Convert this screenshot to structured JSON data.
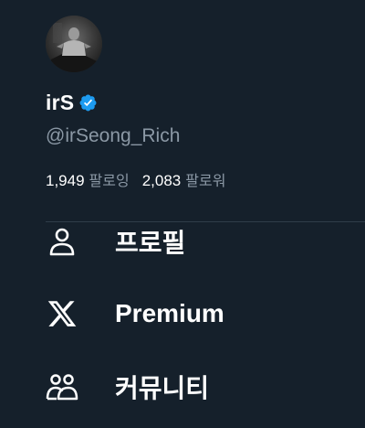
{
  "profile": {
    "display_name": "irS",
    "handle": "@irSeong_Rich",
    "following_count": "1,949",
    "following_label": "팔로잉",
    "followers_count": "2,083",
    "followers_label": "팔로워"
  },
  "menu": [
    {
      "label": "프로필",
      "icon": "person-icon"
    },
    {
      "label": "Premium",
      "icon": "x-logo-icon"
    },
    {
      "label": "커뮤니티",
      "icon": "communities-icon"
    }
  ],
  "colors": {
    "background": "#15202b",
    "text_primary": "#ffffff",
    "text_secondary": "#8b98a5",
    "verified": "#1d9bf0",
    "divider": "#2f3c49"
  }
}
